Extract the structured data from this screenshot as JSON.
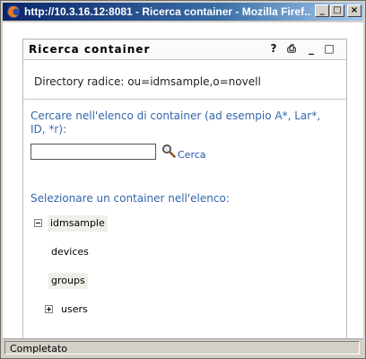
{
  "window": {
    "title": "http://10.3.16.12:8081 - Ricerca container - Mozilla Firef...",
    "minimize_label": "_",
    "maximize_label": "□",
    "close_label": "×"
  },
  "panel": {
    "title": "Ricerca container",
    "help_label": "?",
    "print_label": "⎙",
    "minimize_label": "_",
    "maximize_label": "□"
  },
  "directory": {
    "text": "Directory radice:  ou=idmsample,o=novell"
  },
  "search": {
    "prompt": "Cercare nell'elenco di container (ad esempio A*, Lar*, ID, *r):",
    "value": "",
    "button_label": "Cerca"
  },
  "tree": {
    "prompt": "Selezionare un container nell'elenco:",
    "items": [
      {
        "label": "idmsample",
        "toggle": "collapse"
      },
      {
        "label": "devices"
      },
      {
        "label": "groups"
      },
      {
        "label": "users",
        "toggle": "expand"
      }
    ]
  },
  "status": {
    "text": "Completato"
  },
  "colors": {
    "title_gradient_start": "#0a246a",
    "link": "#3366aa"
  }
}
